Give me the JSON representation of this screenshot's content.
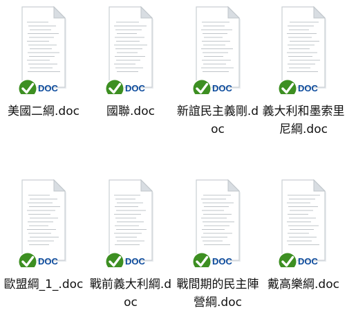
{
  "colors": {
    "page_fold": "#d8dde2",
    "text_lines": "#bfc4c8",
    "check_green": "#3d8f22",
    "doc_text": "#0b4a9c"
  },
  "icons": {
    "file": "word-doc-file-icon",
    "overlay": "green-checkmark-icon"
  },
  "files": [
    {
      "name": "美國二綱.doc",
      "badge": "DOC"
    },
    {
      "name": "國聯.doc",
      "badge": "DOC"
    },
    {
      "name": "新誼民主義剛.doc",
      "badge": "DOC"
    },
    {
      "name": "義大利和墨索里尼綱.doc",
      "badge": "DOC"
    },
    {
      "name": "歐盟綱_1_.doc",
      "badge": "DOC"
    },
    {
      "name": "戰前義大利綱.doc",
      "badge": "DOC"
    },
    {
      "name": "戰間期的民主陣營綱.doc",
      "badge": "DOC"
    },
    {
      "name": "戴高樂綱.doc",
      "badge": "DOC"
    }
  ]
}
